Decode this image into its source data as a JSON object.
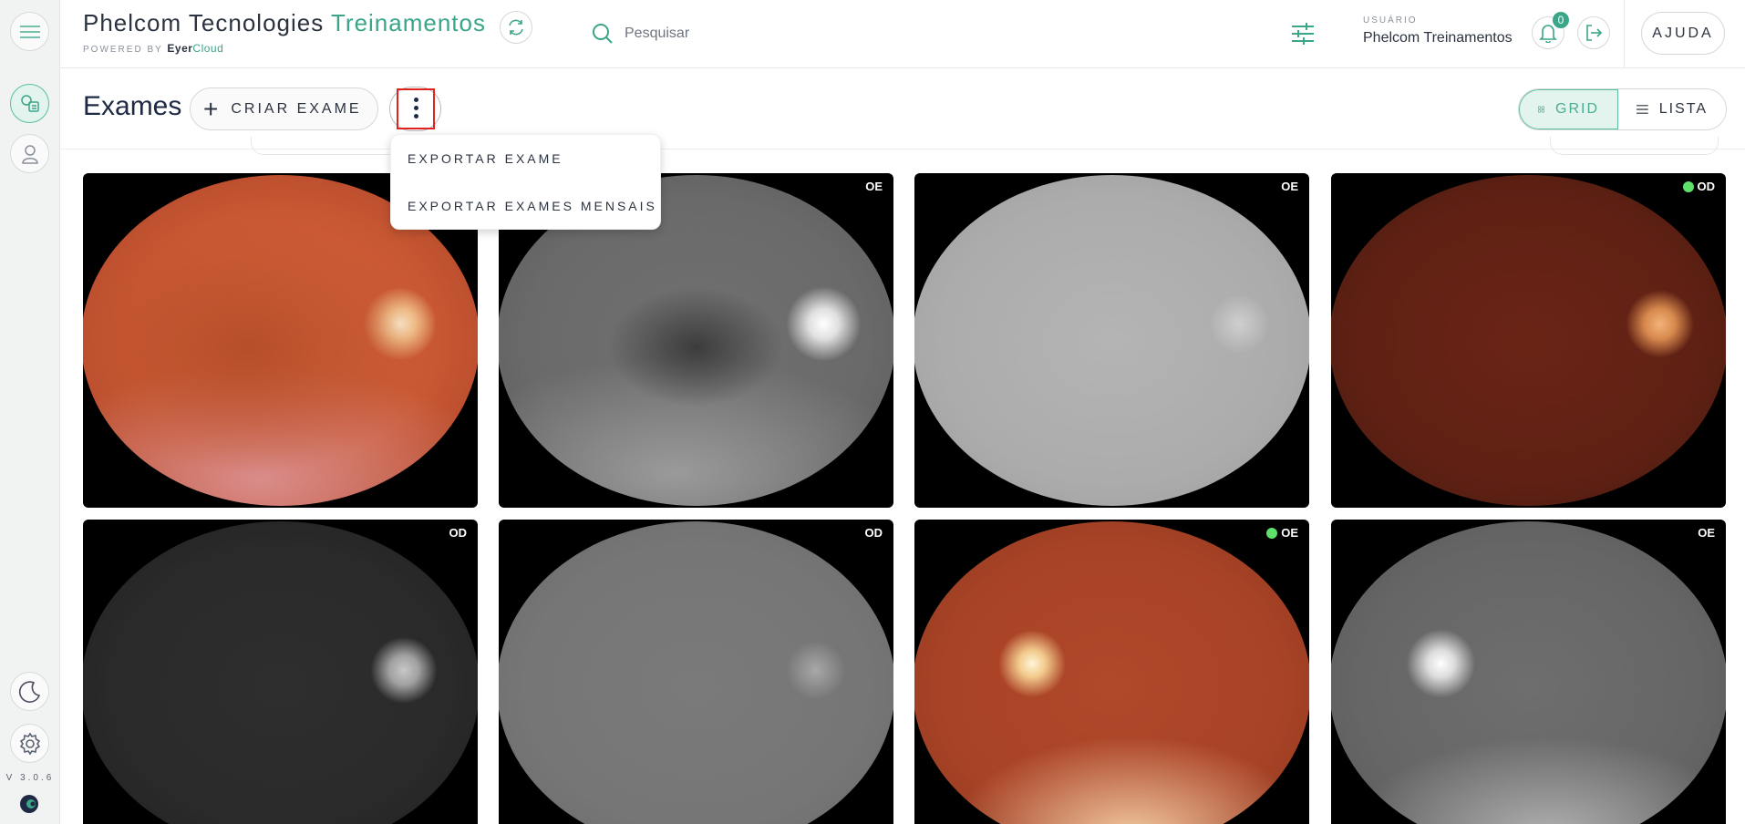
{
  "app": {
    "title_main": "Phelcom Tecnologies",
    "title_accent": "Treinamentos",
    "powered_by": "POWERED BY",
    "powered_brand": "Eyer",
    "powered_cloud": "Cloud",
    "version": "V 3.0.6"
  },
  "search": {
    "placeholder": "Pesquisar",
    "value": ""
  },
  "user": {
    "label": "USUÁRIO",
    "name": "Phelcom Treinamentos",
    "notifications": "0"
  },
  "help_label": "AJUDA",
  "page": {
    "title": "Exames",
    "create_label": "CRIAR EXAME",
    "view_grid_label": "GRID",
    "view_list_label": "LISTA",
    "active_view": "grid"
  },
  "menu": {
    "items": [
      "EXPORTAR EXAME",
      "EXPORTAR EXAMES MENSAIS"
    ]
  },
  "exams": [
    {
      "eye": "",
      "status_dot": false,
      "style": "color-fundus-right"
    },
    {
      "eye": "OE",
      "status_dot": false,
      "style": "redfree-right"
    },
    {
      "eye": "OE",
      "status_dot": false,
      "style": "light-gray"
    },
    {
      "eye": "OD",
      "status_dot": true,
      "style": "dark-red"
    },
    {
      "eye": "OD",
      "status_dot": false,
      "style": "dark-gray"
    },
    {
      "eye": "OD",
      "status_dot": false,
      "style": "mid-gray"
    },
    {
      "eye": "OE",
      "status_dot": true,
      "style": "color-fundus-left"
    },
    {
      "eye": "OE",
      "status_dot": false,
      "style": "redfree-left"
    }
  ],
  "colors": {
    "accent": "#3aa589",
    "highlight_box": "#e0231e",
    "status_dot": "#5ee06a"
  }
}
